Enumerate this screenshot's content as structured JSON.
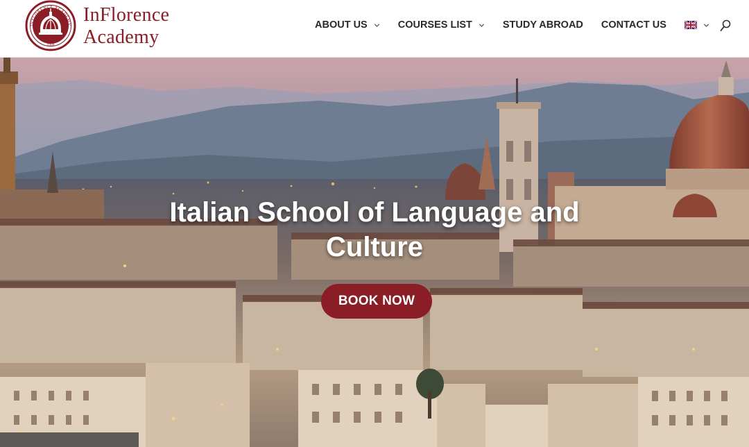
{
  "brand": {
    "name_line1": "InFlorence",
    "name_line2": "Academy",
    "seal_text_top": "INFLORENCE ACADEMY",
    "seal_year": "1988",
    "color": "#8a1d26"
  },
  "nav": {
    "items": [
      {
        "label": "ABOUT US",
        "has_dropdown": true
      },
      {
        "label": "COURSES LIST",
        "has_dropdown": true
      },
      {
        "label": "STUDY ABROAD",
        "has_dropdown": false
      },
      {
        "label": "CONTACT US",
        "has_dropdown": false
      }
    ],
    "language_icon": "uk-flag-icon",
    "search_icon": "search-icon"
  },
  "hero": {
    "title": "Italian School of Language and Culture",
    "cta_label": "BOOK NOW",
    "cta_color": "#8a1d26"
  }
}
